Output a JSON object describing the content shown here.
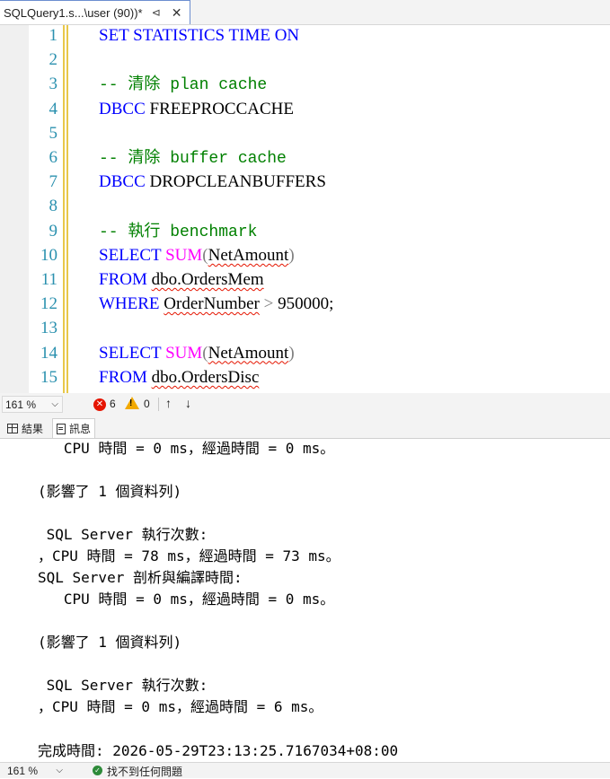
{
  "tab": {
    "title": "SQLQuery1.s...\\user (90))*",
    "pin_icon": "pin-icon",
    "close_icon": "close-icon"
  },
  "editor": {
    "lines": [
      {
        "n": "1",
        "segments": [
          {
            "t": "SET STATISTICS TIME ON",
            "c": "kw"
          }
        ]
      },
      {
        "n": "2",
        "segments": []
      },
      {
        "n": "3",
        "segments": [
          {
            "t": "-- 清除 plan cache",
            "c": "cm"
          }
        ]
      },
      {
        "n": "4",
        "segments": [
          {
            "t": "DBCC",
            "c": "kw"
          },
          {
            "t": " FREEPROCCACHE",
            "c": "tx"
          }
        ]
      },
      {
        "n": "5",
        "segments": []
      },
      {
        "n": "6",
        "segments": [
          {
            "t": "-- 清除 buffer cache",
            "c": "cm"
          }
        ]
      },
      {
        "n": "7",
        "segments": [
          {
            "t": "DBCC",
            "c": "kw"
          },
          {
            "t": " DROPCLEANBUFFERS",
            "c": "tx"
          }
        ]
      },
      {
        "n": "8",
        "segments": []
      },
      {
        "n": "9",
        "segments": [
          {
            "t": "-- 執行 benchmark",
            "c": "cm"
          }
        ]
      },
      {
        "n": "10",
        "segments": [
          {
            "t": "SELECT ",
            "c": "kw"
          },
          {
            "t": "SUM",
            "c": "fn"
          },
          {
            "t": "(",
            "c": "op"
          },
          {
            "t": "NetAmount",
            "c": "tx sq"
          },
          {
            "t": ")",
            "c": "op"
          }
        ]
      },
      {
        "n": "11",
        "segments": [
          {
            "t": "FROM ",
            "c": "kw"
          },
          {
            "t": "dbo.OrdersMem",
            "c": "tx sq"
          }
        ]
      },
      {
        "n": "12",
        "segments": [
          {
            "t": "WHERE ",
            "c": "kw"
          },
          {
            "t": "OrderNumber",
            "c": "tx sq"
          },
          {
            "t": " > ",
            "c": "op"
          },
          {
            "t": "950000;",
            "c": "tx"
          }
        ]
      },
      {
        "n": "13",
        "segments": []
      },
      {
        "n": "14",
        "segments": [
          {
            "t": "SELECT ",
            "c": "kw"
          },
          {
            "t": "SUM",
            "c": "fn"
          },
          {
            "t": "(",
            "c": "op"
          },
          {
            "t": "NetAmount",
            "c": "tx sq"
          },
          {
            "t": ")",
            "c": "op"
          }
        ]
      },
      {
        "n": "15",
        "segments": [
          {
            "t": "FROM ",
            "c": "kw"
          },
          {
            "t": "dbo.OrdersDisc",
            "c": "tx sq"
          }
        ]
      }
    ]
  },
  "editor_status": {
    "zoom": "161 %",
    "errors": "6",
    "warnings": "0",
    "up_icon": "arrow-up-icon",
    "down_icon": "arrow-down-icon"
  },
  "result_tabs": {
    "results": "結果",
    "messages": "訊息"
  },
  "messages": [
    "   CPU 時間 = 0 ms，經過時間 = 0 ms。",
    "",
    "(影響了 1 個資料列)",
    "",
    " SQL Server 執行次數:",
    "，CPU 時間 = 78 ms，經過時間 = 73 ms。",
    "SQL Server 剖析與編譯時間:",
    "   CPU 時間 = 0 ms，經過時間 = 0 ms。",
    "",
    "(影響了 1 個資料列)",
    "",
    " SQL Server 執行次數:",
    "，CPU 時間 = 0 ms，經過時間 = 6 ms。",
    "",
    "完成時間: 2026-05-29T23:13:25.7167034+08:00"
  ],
  "bottom_status": {
    "zoom": "161 %",
    "status": "找不到任何問題"
  },
  "colors": {
    "keyword": "#0000ff",
    "function": "#ff00ff",
    "comment": "#008000",
    "line_number": "#2b91af",
    "error": "#e51400",
    "warning": "#f2a900",
    "ok": "#2e8b3a"
  }
}
